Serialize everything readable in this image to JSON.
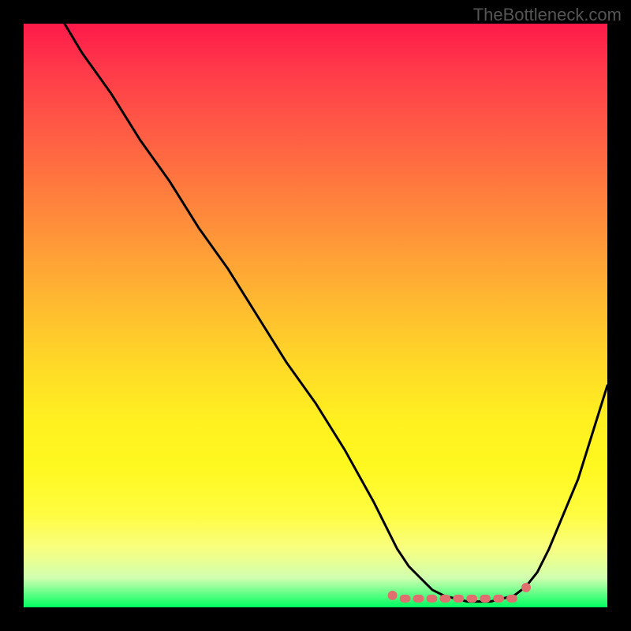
{
  "watermark": "TheBottleneck.com",
  "chart_data": {
    "type": "line",
    "title": "",
    "xlabel": "",
    "ylabel": "",
    "xlim": [
      0,
      100
    ],
    "ylim": [
      0,
      100
    ],
    "background_gradient": {
      "top": "#ff1a4a",
      "mid_upper": "#ff9a38",
      "mid_lower": "#fff020",
      "bottom": "#00ff60"
    },
    "series": [
      {
        "name": "bottleneck-curve",
        "color": "#000000",
        "x": [
          7,
          10,
          15,
          20,
          25,
          30,
          35,
          40,
          45,
          50,
          55,
          60,
          62,
          64,
          66,
          68,
          70,
          72,
          74,
          76,
          78,
          80,
          82,
          84,
          86,
          88,
          90,
          95,
          100
        ],
        "y": [
          100,
          95,
          88,
          80,
          73,
          65,
          58,
          50,
          42,
          35,
          27,
          18,
          14,
          10,
          7,
          5,
          3,
          2,
          1.5,
          1,
          1,
          1,
          1.5,
          2,
          3.5,
          6,
          10,
          22,
          38
        ]
      }
    ],
    "optimal_zone_markers": {
      "color": "#e07070",
      "style": "dotted-capsules",
      "x_range": [
        64,
        85
      ],
      "y": 1.5
    }
  }
}
